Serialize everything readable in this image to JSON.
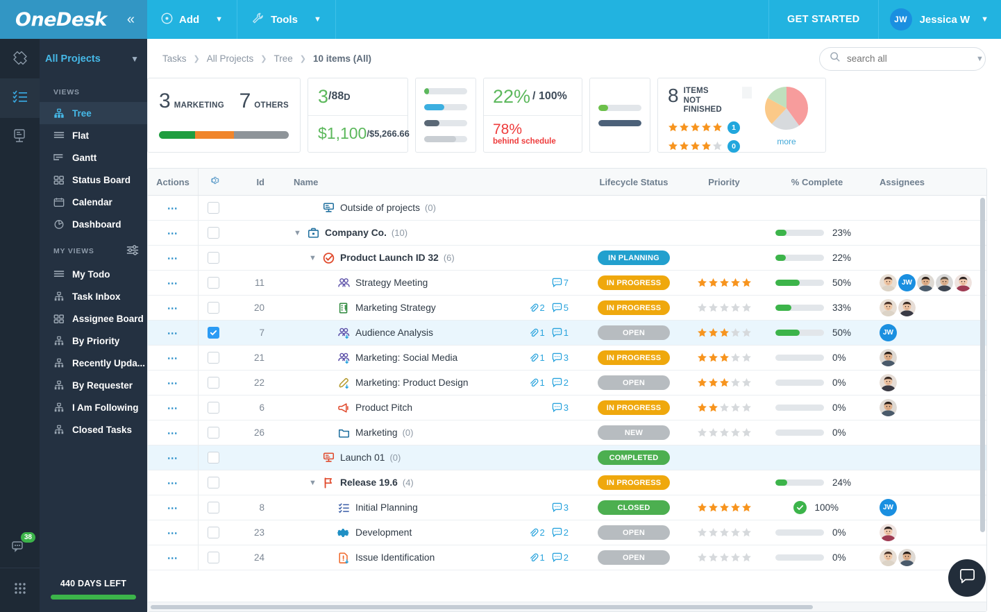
{
  "topbar": {
    "logo": "OneDesk",
    "collapse_icon": "chevrons-left-icon",
    "add_label": "Add",
    "tools_label": "Tools",
    "get_started_label": "GET STARTED",
    "user_initials": "JW",
    "user_name": "Jessica W"
  },
  "rail": {
    "items": [
      {
        "icon": "ticket-icon",
        "active": false
      },
      {
        "icon": "checklist-icon",
        "active": true
      },
      {
        "icon": "presentation-icon",
        "active": false
      }
    ],
    "chat_icon": "chat-bubbles-icon",
    "chat_badge": "38",
    "apps_icon": "grid-apps-icon"
  },
  "sidebar": {
    "project_selector": "All Projects",
    "views_header": "VIEWS",
    "views": [
      {
        "label": "Tree",
        "icon": "tree-icon",
        "active": true
      },
      {
        "label": "Flat",
        "icon": "list-icon",
        "active": false
      },
      {
        "label": "Gantt",
        "icon": "gantt-icon",
        "active": false
      },
      {
        "label": "Status Board",
        "icon": "board-icon",
        "active": false
      },
      {
        "label": "Calendar",
        "icon": "calendar-icon",
        "active": false
      },
      {
        "label": "Dashboard",
        "icon": "pie-icon",
        "active": false
      }
    ],
    "my_views_header": "MY VIEWS",
    "my_views": [
      {
        "label": "My Todo",
        "icon": "list-icon"
      },
      {
        "label": "Task Inbox",
        "icon": "tree-icon"
      },
      {
        "label": "Assignee Board",
        "icon": "board-icon"
      },
      {
        "label": "By Priority",
        "icon": "tree-icon"
      },
      {
        "label": "Recently Upda...",
        "icon": "tree-icon"
      },
      {
        "label": "By Requester",
        "icon": "tree-icon"
      },
      {
        "label": "I Am Following",
        "icon": "tree-icon"
      },
      {
        "label": "Closed Tasks",
        "icon": "tree-icon"
      }
    ],
    "trial_label": "440 DAYS LEFT"
  },
  "breadcrumb": {
    "items": [
      "Tasks",
      "All Projects",
      "Tree",
      "10 items (All)"
    ],
    "separator": "›"
  },
  "search": {
    "placeholder": "search all",
    "value": "",
    "icon": "search-icon",
    "caret": "chevron-down-icon"
  },
  "kpi": {
    "card_counts": {
      "marketing_value": "3",
      "marketing_label": "MARKETING",
      "others_value": "7",
      "others_label": "OTHERS",
      "segments": [
        {
          "color": "#1f9d3f",
          "pct": 28
        },
        {
          "color": "#f0852b",
          "pct": 30
        },
        {
          "color": "#8e9499",
          "pct": 42
        }
      ]
    },
    "card_budget": {
      "days_value": "3",
      "days_total": "/88",
      "days_unit": " D",
      "cost_value": "$1,100",
      "cost_total": "/$5,266.66"
    },
    "card_bars_a": [
      {
        "color": "#5cb85c",
        "pct": 11
      },
      {
        "color": "#3cafe0",
        "pct": 46
      },
      {
        "color": "#5a6876",
        "pct": 35
      },
      {
        "color": "#c9ced3",
        "pct": 74
      }
    ],
    "card_progress": {
      "pct_value": "22%",
      "pct_total": "/ 100%",
      "behind_value": "78%",
      "behind_label": "behind schedule"
    },
    "card_bars_b": [
      {
        "color": "#6cc04a",
        "pct": 22
      },
      {
        "color": "#4c6179",
        "pct": 100
      }
    ],
    "card_items": {
      "count": "8",
      "label_line1": "ITEMS",
      "label_line2": "NOT FINISHED",
      "ratings": [
        {
          "filled": 5,
          "count": "1"
        },
        {
          "filled": 4,
          "count": "0"
        }
      ],
      "more_label": "more",
      "pie": [
        {
          "color": "#f79c9c",
          "pct": 40
        },
        {
          "color": "#d7dadd",
          "pct": 22
        },
        {
          "color": "#fbc988",
          "pct": 21
        },
        {
          "color": "#bfe0bd",
          "pct": 17
        }
      ]
    }
  },
  "table": {
    "columns": {
      "actions": "Actions",
      "settings_icon": "gear-icon",
      "id": "Id",
      "name": "Name",
      "status": "Lifecycle Status",
      "priority": "Priority",
      "percent": "% Complete",
      "assignees": "Assignees"
    },
    "rows": [
      {
        "id": "",
        "name": "Outside of projects",
        "count": "(0)",
        "indent": 2,
        "icon": "outside-projects-icon",
        "icon_color": "#1f6f9e",
        "expander": "",
        "bold": false,
        "status": "",
        "status_color": "",
        "stars": null,
        "pct": null,
        "pct_text": "",
        "assignees": [],
        "attachments": "",
        "comments": "",
        "checked": false,
        "selected": false
      },
      {
        "id": "",
        "name": "Company Co.",
        "count": "(10)",
        "indent": 1,
        "icon": "briefcase-icon",
        "icon_color": "#1f6f9e",
        "expander": "chevron-down-icon",
        "bold": true,
        "status": "",
        "status_color": "",
        "stars": null,
        "pct": 23,
        "pct_text": "23%",
        "assignees": [],
        "attachments": "",
        "comments": "",
        "checked": false,
        "selected": false
      },
      {
        "id": "",
        "name": "Product Launch ID 32",
        "count": "(6)",
        "indent": 2,
        "icon": "check-circle-icon",
        "icon_color": "#e0492b",
        "expander": "chevron-down-icon",
        "bold": true,
        "status": "IN PLANNING",
        "status_color": "#22a0ce",
        "stars": null,
        "pct": 22,
        "pct_text": "22%",
        "assignees": [],
        "attachments": "",
        "comments": "",
        "checked": false,
        "selected": false
      },
      {
        "id": "11",
        "name": "Strategy Meeting",
        "count": "",
        "indent": 3,
        "icon": "meeting-icon",
        "icon_color": "#5b4fa8",
        "expander": "",
        "bold": false,
        "status": "IN PROGRESS",
        "status_color": "#efa80d",
        "stars": 5,
        "pct": 50,
        "pct_text": "50%",
        "assignees": [
          "f1",
          "JW",
          "m1",
          "m2",
          "f2"
        ],
        "attachments": "",
        "comments": "7",
        "checked": false,
        "selected": false
      },
      {
        "id": "20",
        "name": "Marketing Strategy",
        "count": "",
        "indent": 3,
        "icon": "money-building-icon",
        "icon_color": "#2f8a3e",
        "expander": "",
        "bold": false,
        "status": "IN PROGRESS",
        "status_color": "#efa80d",
        "stars": 0,
        "pct": 33,
        "pct_text": "33%",
        "assignees": [
          "f1",
          "f3"
        ],
        "attachments": "2",
        "comments": "5",
        "checked": false,
        "selected": false
      },
      {
        "id": "7",
        "name": "Audience Analysis",
        "count": "",
        "indent": 3,
        "icon": "meeting-down-icon",
        "icon_color": "#5b4fa8",
        "expander": "",
        "bold": false,
        "status": "OPEN",
        "status_color": "#b7bcc0",
        "stars": 3,
        "pct": 50,
        "pct_text": "50%",
        "assignees": [
          "JW"
        ],
        "attachments": "1",
        "comments": "1",
        "checked": true,
        "selected": true
      },
      {
        "id": "21",
        "name": "Marketing: Social Media",
        "count": "",
        "indent": 3,
        "icon": "meeting-down-icon",
        "icon_color": "#5b4fa8",
        "expander": "",
        "bold": false,
        "status": "IN PROGRESS",
        "status_color": "#efa80d",
        "stars": 3,
        "pct": 0,
        "pct_text": "0%",
        "assignees": [
          "m1"
        ],
        "attachments": "1",
        "comments": "3",
        "checked": false,
        "selected": false
      },
      {
        "id": "22",
        "name": "Marketing: Product Design",
        "count": "",
        "indent": 3,
        "icon": "pencil-down-icon",
        "icon_color": "#b49a2e",
        "expander": "",
        "bold": false,
        "status": "OPEN",
        "status_color": "#b7bcc0",
        "stars": 3,
        "pct": 0,
        "pct_text": "0%",
        "assignees": [
          "f3"
        ],
        "attachments": "1",
        "comments": "2",
        "checked": false,
        "selected": false
      },
      {
        "id": "6",
        "name": "Product Pitch",
        "count": "",
        "indent": 3,
        "icon": "megaphone-icon",
        "icon_color": "#e0492b",
        "expander": "",
        "bold": false,
        "status": "IN PROGRESS",
        "status_color": "#efa80d",
        "stars": 2,
        "pct": 0,
        "pct_text": "0%",
        "assignees": [
          "m1"
        ],
        "attachments": "",
        "comments": "3",
        "checked": false,
        "selected": false
      },
      {
        "id": "26",
        "name": "Marketing",
        "count": "(0)",
        "indent": 3,
        "icon": "folder-icon",
        "icon_color": "#1f6f9e",
        "expander": "",
        "bold": false,
        "status": "NEW",
        "status_color": "#b7bcc0",
        "stars": 0,
        "pct": 0,
        "pct_text": "0%",
        "assignees": [],
        "attachments": "",
        "comments": "",
        "checked": false,
        "selected": false
      },
      {
        "id": "",
        "name": "Launch 01",
        "count": "(0)",
        "indent": 2,
        "icon": "outside-projects-icon",
        "icon_color": "#e0492b",
        "expander": "",
        "bold": false,
        "status": "COMPLETED",
        "status_color": "#4caf50",
        "stars": null,
        "pct": null,
        "pct_text": "",
        "assignees": [],
        "attachments": "",
        "comments": "",
        "checked": false,
        "selected": true
      },
      {
        "id": "",
        "name": "Release 19.6",
        "count": "(4)",
        "indent": 2,
        "icon": "flag-icon",
        "icon_color": "#e0492b",
        "expander": "chevron-down-icon",
        "bold": true,
        "status": "IN PROGRESS",
        "status_color": "#efa80d",
        "stars": null,
        "pct": 24,
        "pct_text": "24%",
        "assignees": [],
        "attachments": "",
        "comments": "",
        "checked": false,
        "selected": false
      },
      {
        "id": "8",
        "name": "Initial Planning",
        "count": "",
        "indent": 3,
        "icon": "checklist-task-icon",
        "icon_color": "#3c5fa8",
        "expander": "",
        "bold": false,
        "status": "CLOSED",
        "status_color": "#4caf50",
        "stars": 5,
        "pct": 100,
        "pct_text": "100%",
        "assignees": [
          "JW"
        ],
        "attachments": "",
        "comments": "3",
        "checked": false,
        "selected": false
      },
      {
        "id": "23",
        "name": "Development",
        "count": "",
        "indent": 3,
        "icon": "gear-icon",
        "icon_color": "#1f8fc4",
        "expander": "",
        "bold": false,
        "status": "OPEN",
        "status_color": "#b7bcc0",
        "stars": 0,
        "pct": 0,
        "pct_text": "0%",
        "assignees": [
          "f2"
        ],
        "attachments": "2",
        "comments": "2",
        "checked": false,
        "selected": false
      },
      {
        "id": "24",
        "name": "Issue Identification",
        "count": "",
        "indent": 3,
        "icon": "alert-doc-down-icon",
        "icon_color": "#f0682b",
        "expander": "",
        "bold": false,
        "status": "OPEN",
        "status_color": "#b7bcc0",
        "stars": 0,
        "pct": 0,
        "pct_text": "0%",
        "assignees": [
          "f1",
          "m1"
        ],
        "attachments": "1",
        "comments": "2",
        "checked": false,
        "selected": false
      }
    ]
  },
  "chat_fab": {
    "icon": "chat-icon"
  }
}
